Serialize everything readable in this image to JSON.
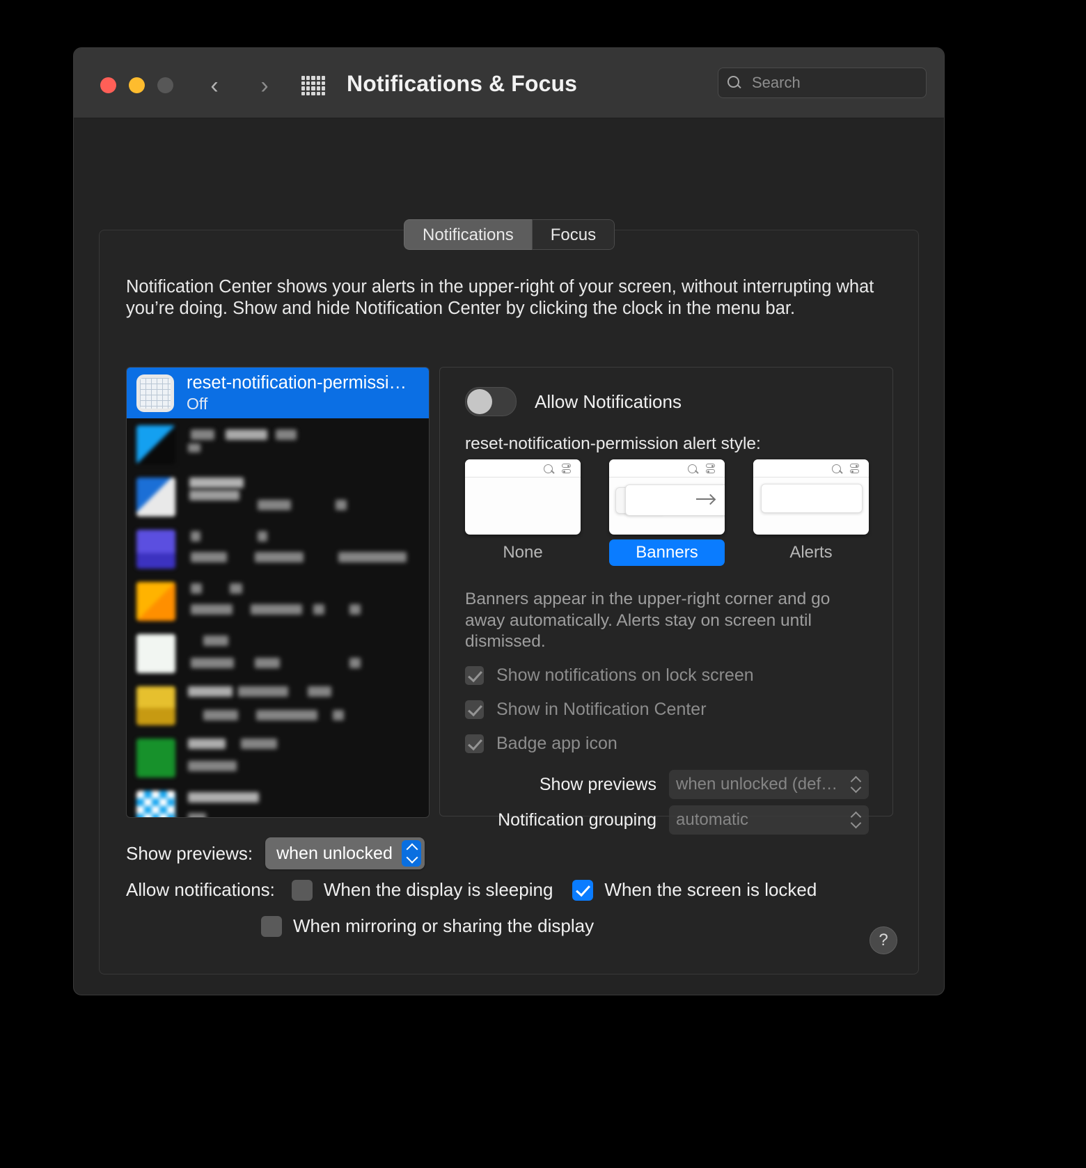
{
  "window": {
    "title": "Notifications & Focus",
    "traffic_lights": [
      "close",
      "minimize",
      "zoom"
    ],
    "back_label": "‹",
    "forward_label": "›",
    "grid_icon": "show-all-icon"
  },
  "search": {
    "placeholder": "Search",
    "value": "",
    "icon": "search-icon"
  },
  "tabs": [
    {
      "label": "Notifications",
      "selected": true
    },
    {
      "label": "Focus",
      "selected": false
    }
  ],
  "intro": "Notification Center shows your alerts in the upper-right of your screen, without interrupting what you’re doing. Show and hide Notification Center by clicking the clock in the menu bar.",
  "app_list": {
    "selected_app": {
      "name": "reset-notification-permissi…",
      "state": "Off",
      "icon": "globe-app-icon"
    },
    "obscured_row_count": 11
  },
  "detail": {
    "allow_notifications": {
      "label": "Allow Notifications",
      "value": "off"
    },
    "alert_style_label": "reset-notification-permission alert style:",
    "alert_styles": [
      {
        "label": "None",
        "selected": false,
        "thumb": "empty-notification-preview"
      },
      {
        "label": "Banners",
        "selected": true,
        "thumb": "banner-notification-preview"
      },
      {
        "label": "Alerts",
        "selected": false,
        "thumb": "alert-notification-preview"
      }
    ],
    "style_description": "Banners appear in the upper-right corner and go away automatically. Alerts stay on screen until dismissed.",
    "checkboxes": [
      {
        "label": "Show notifications on lock screen",
        "checked": true,
        "disabled": true
      },
      {
        "label": "Show in Notification Center",
        "checked": true,
        "disabled": true
      },
      {
        "label": "Badge app icon",
        "checked": true,
        "disabled": true
      }
    ],
    "popups": [
      {
        "label": "Show previews",
        "value": "when unlocked (def…",
        "disabled": true
      },
      {
        "label": "Notification grouping",
        "value": "automatic",
        "disabled": true
      }
    ]
  },
  "footer": {
    "show_previews_label": "Show previews:",
    "show_previews_value": "when unlocked",
    "allow_notifications_label": "Allow notifications:",
    "allow_options": [
      {
        "label": "When the display is sleeping",
        "checked": false
      },
      {
        "label": "When the screen is locked",
        "checked": true
      },
      {
        "label": "When mirroring or sharing the display",
        "checked": false
      }
    ],
    "help_label": "?"
  },
  "colors": {
    "accent": "#0a7cff",
    "selection": "#0b6fe4",
    "window_bg": "#232323",
    "titlebar_bg": "#363636",
    "list_bg": "#111111"
  }
}
